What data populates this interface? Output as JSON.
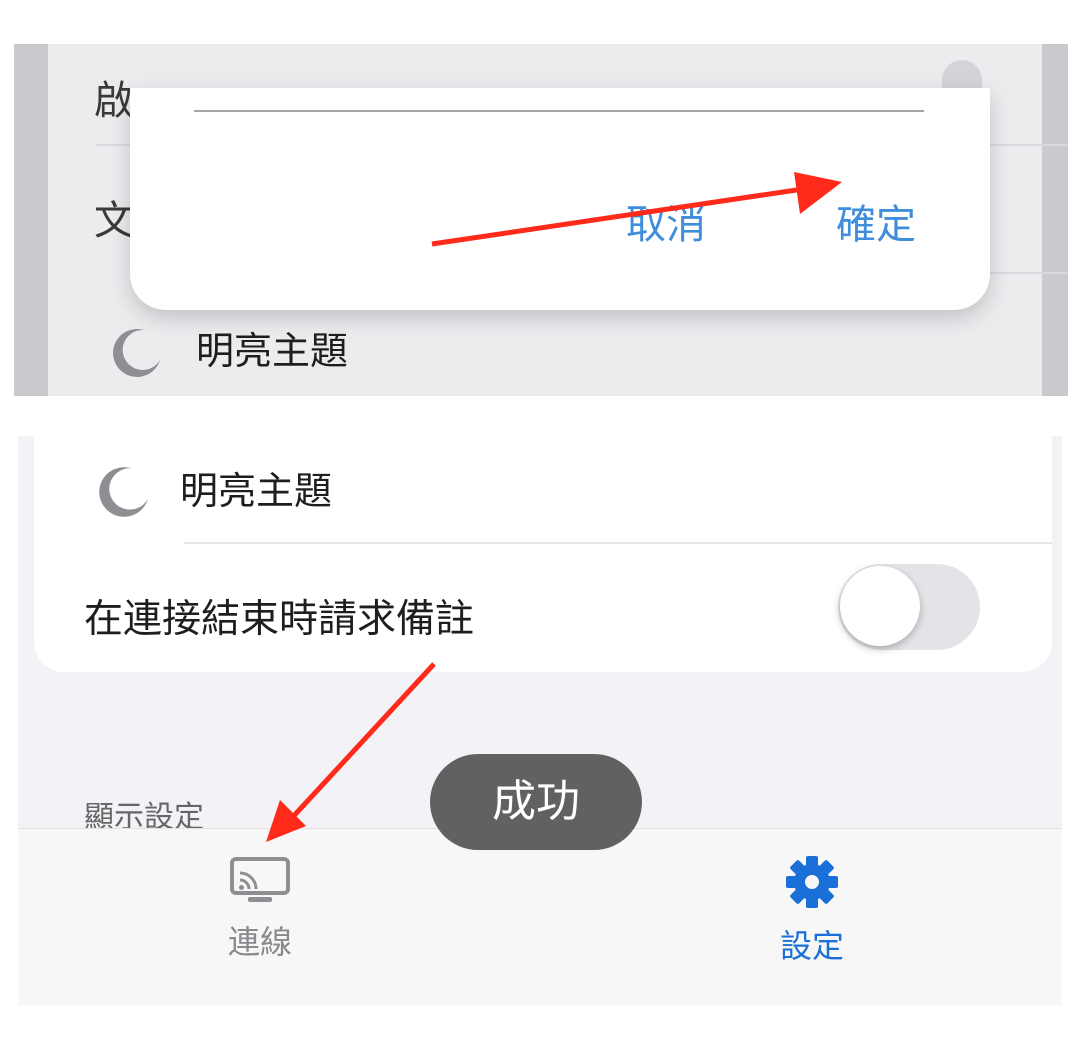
{
  "top_panel": {
    "clipped_row_1": "啟",
    "clipped_row_2": "文",
    "theme_row_label": "明亮主題",
    "dialog": {
      "cancel_label": "取消",
      "confirm_label": "確定"
    }
  },
  "bottom_panel": {
    "theme_row_label": "明亮主題",
    "request_note_label": "在連接結束時請求備註",
    "request_note_enabled": false,
    "section_label": "顯示設定",
    "toast_text": "成功",
    "tabs": [
      {
        "label": "連線",
        "icon": "cast-screen-icon",
        "selected": false
      },
      {
        "label": "設定",
        "icon": "gear-icon",
        "selected": true
      }
    ]
  },
  "colors": {
    "accent_blue": "#1a6fd8",
    "dialog_button_blue": "#3f8edb",
    "annotation_arrow": "#ff2a1a"
  }
}
